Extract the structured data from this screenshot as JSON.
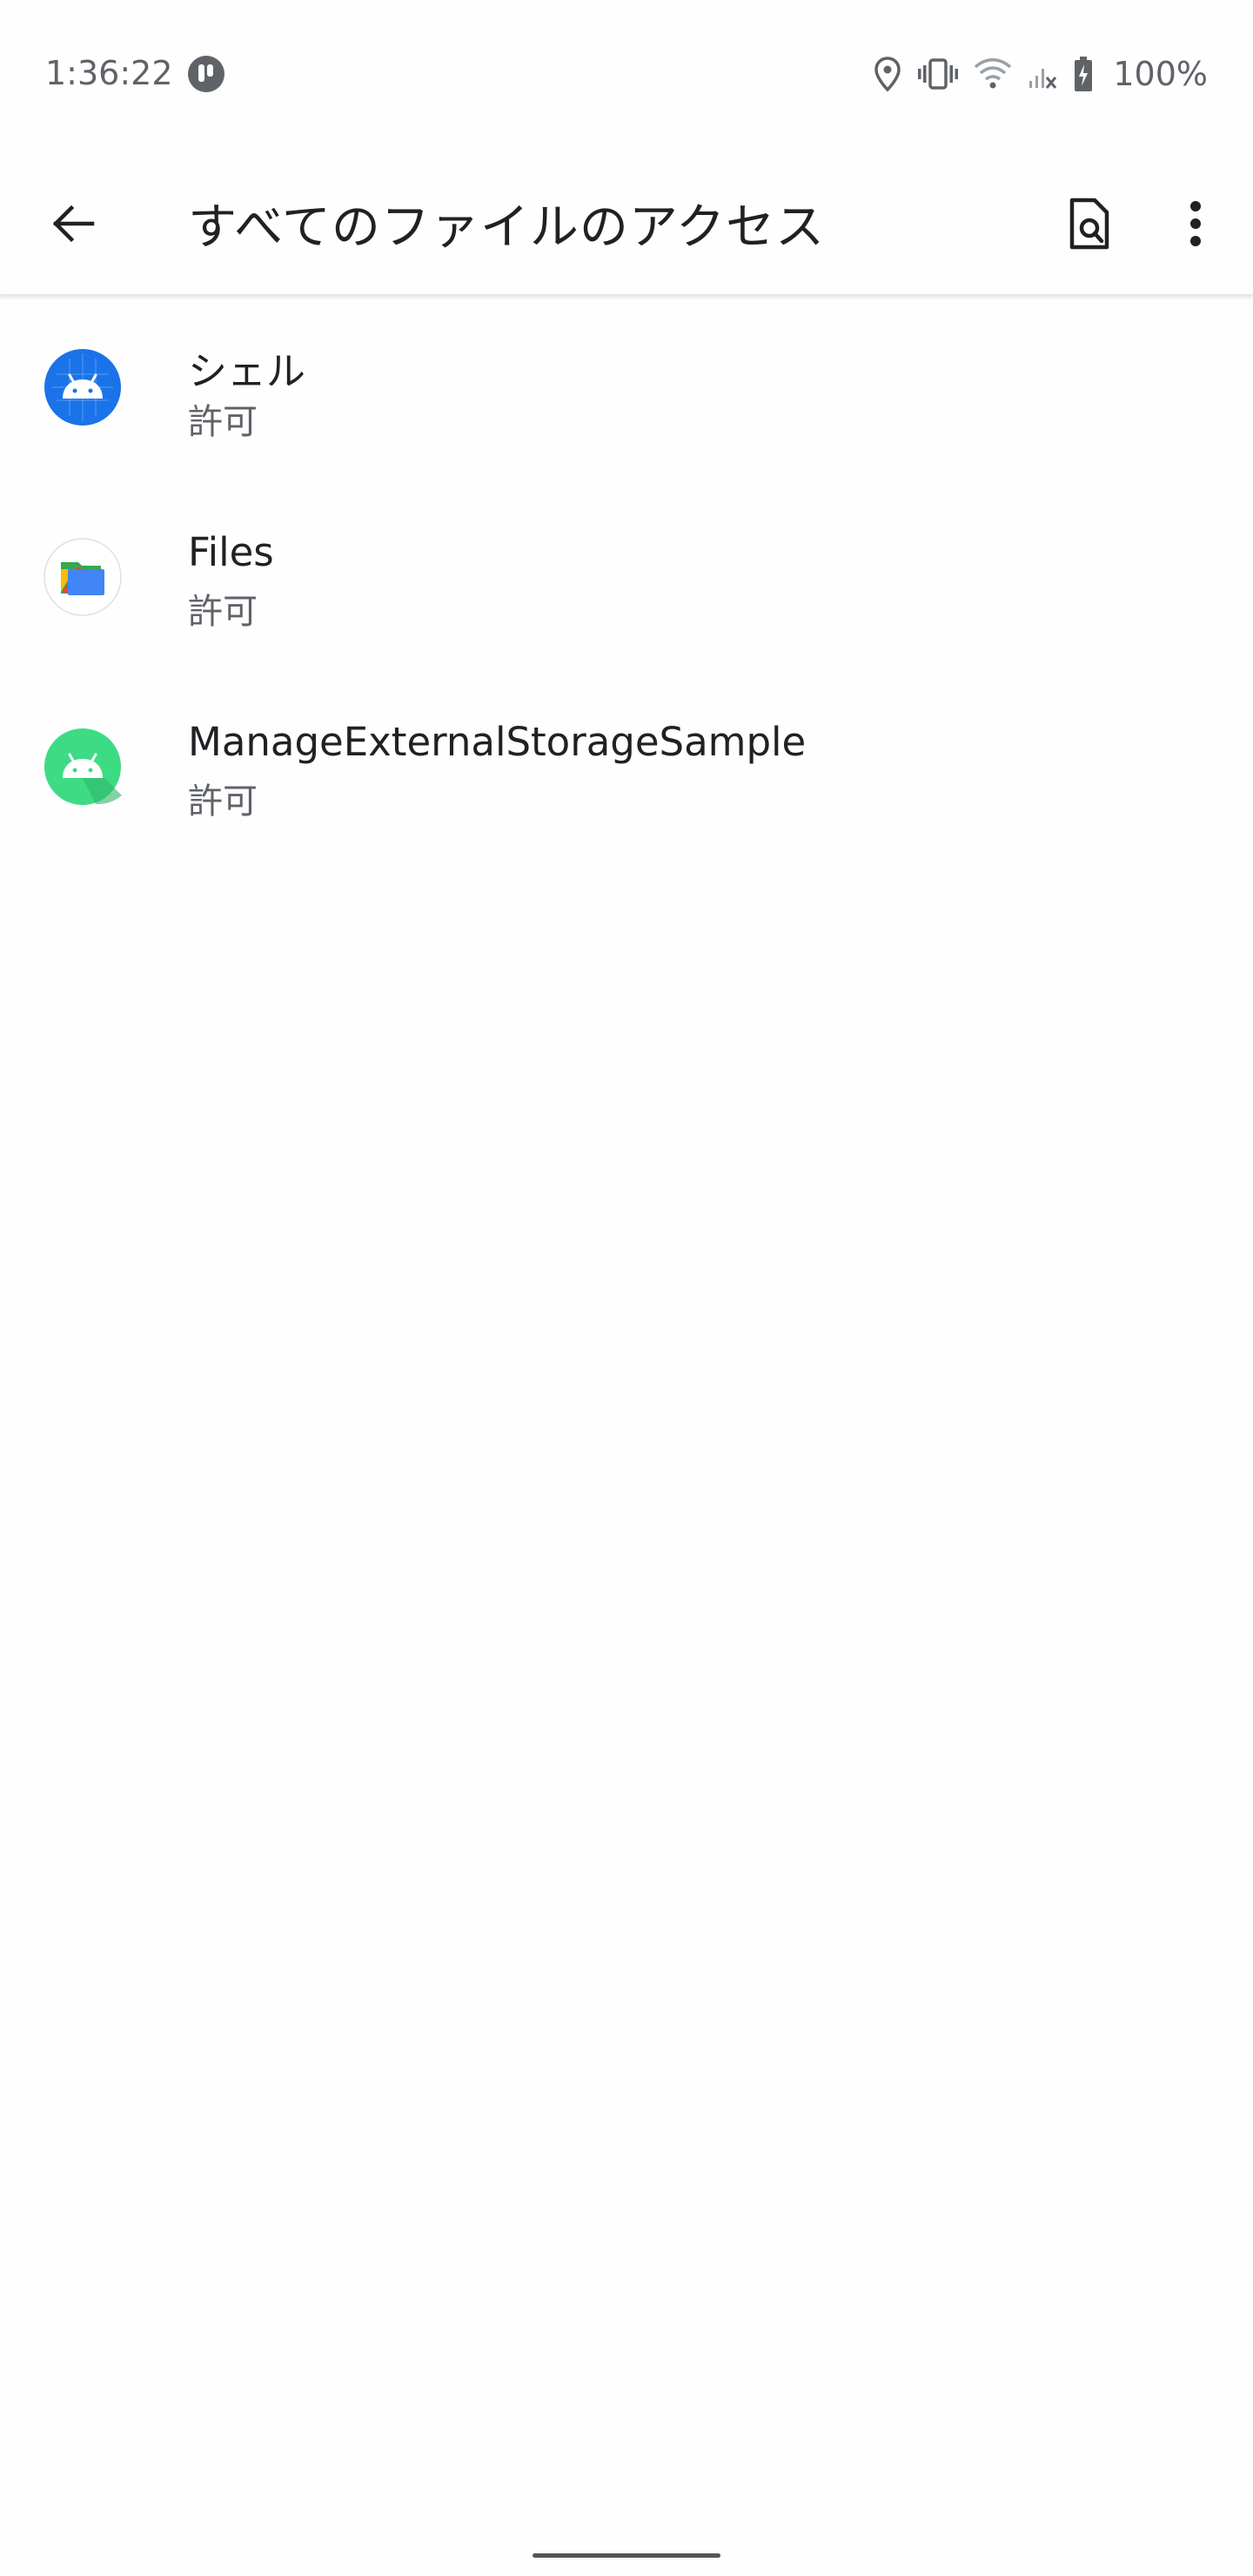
{
  "status_bar": {
    "time": "1:36:22",
    "battery": "100%",
    "icons": [
      "notification-app-icon",
      "location-icon",
      "vibrate-icon",
      "wifi-icon",
      "no-signal-icon",
      "battery-charging-icon"
    ]
  },
  "app_bar": {
    "title": "すべてのファイルのアクセス",
    "back_icon": "arrow-back-icon",
    "search_icon": "search-document-icon",
    "more_icon": "more-vert-icon"
  },
  "apps": [
    {
      "name": "シェル",
      "status": "許可",
      "icon": "android-shell-icon",
      "icon_color": "#1a73e8"
    },
    {
      "name": "Files",
      "status": "許可",
      "icon": "files-app-icon",
      "icon_color": "#4285f4"
    },
    {
      "name": "ManageExternalStorageSample",
      "status": "許可",
      "icon": "android-app-icon",
      "icon_color": "#3ddc84"
    }
  ]
}
